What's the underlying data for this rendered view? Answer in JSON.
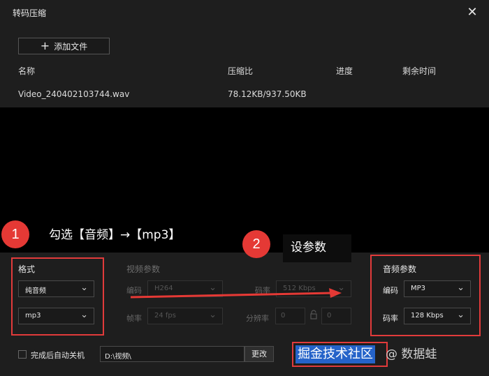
{
  "window": {
    "title": "转码压缩",
    "close_glyph": "✕"
  },
  "toolbar": {
    "add_label": "添加文件",
    "add_icon": "plus-icon"
  },
  "table": {
    "headers": [
      "名称",
      "压缩比",
      "进度",
      "剩余时间"
    ],
    "rows": [
      {
        "name": "Video_240402103744.wav",
        "ratio": "78.12KB/937.50KB",
        "progress": "",
        "remaining": ""
      }
    ]
  },
  "annotations": {
    "step1_number": "1",
    "step1_text": "勾选【音频】→【mp3】",
    "step2_number": "2",
    "step2_text": "设参数",
    "color": "#e53935"
  },
  "format": {
    "title": "格式",
    "type_value": "纯音频",
    "container_value": "mp3"
  },
  "video_params": {
    "title": "视频参数",
    "codec_label": "编码",
    "codec_value": "H264",
    "fps_label": "帧率",
    "fps_value": "24 fps",
    "bitrate_label": "码率",
    "bitrate_value": "512 Kbps",
    "resolution_label": "分辨率",
    "width_value": "0",
    "height_value": "0"
  },
  "audio_params": {
    "title": "音频参数",
    "codec_label": "编码",
    "codec_value": "MP3",
    "bitrate_label": "码率",
    "bitrate_value": "128 Kbps"
  },
  "footer": {
    "shutdown_label": "完成后自动关机",
    "shutdown_checked": false,
    "output_path": "D:\\视频\\",
    "change_label": "更改"
  },
  "watermark": {
    "text": "掘金技术社区",
    "suffix": "@ 数据蛙"
  }
}
